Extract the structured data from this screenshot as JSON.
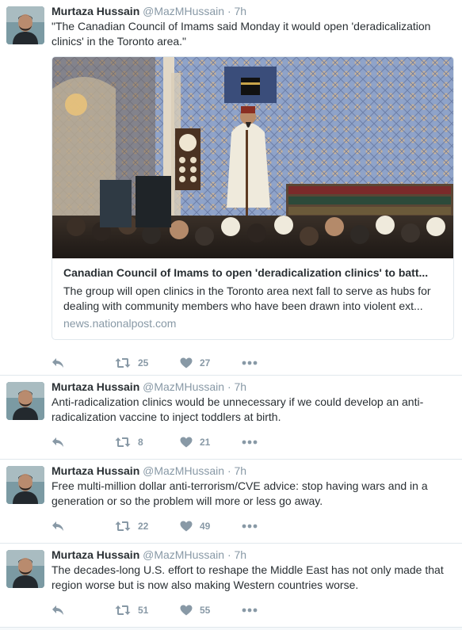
{
  "colors": {
    "text": "#292f33",
    "muted": "#8899a6",
    "border": "#e1e8ed",
    "background": "#f5f8fa"
  },
  "icons": {
    "reply": "reply-icon",
    "retweet": "retweet-icon",
    "like": "heart-icon",
    "more": "more-icon"
  },
  "tweets": [
    {
      "name": "Murtaza Hussain",
      "handle": "@MazMHussain",
      "time": "· 7h",
      "text": "\"The Canadian Council of Imams said Monday it would open 'deradicalization clinics' in the Toronto area.\"",
      "card": {
        "title": "Canadian Council of Imams to open 'deradicalization clinics' to batt...",
        "description": "The group will open clinics in the Toronto area next fall to serve as hubs for dealing with community members who have been drawn into violent ext...",
        "url": "news.nationalpost.com"
      },
      "retweets": "25",
      "likes": "27"
    },
    {
      "name": "Murtaza Hussain",
      "handle": "@MazMHussain",
      "time": "· 7h",
      "text": "Anti-radicalization clinics would be unnecessary if we could develop an anti-radicalization vaccine to inject toddlers at birth.",
      "retweets": "8",
      "likes": "21"
    },
    {
      "name": "Murtaza Hussain",
      "handle": "@MazMHussain",
      "time": "· 7h",
      "text": "Free multi-million dollar anti-terrorism/CVE advice: stop having wars and in a generation or so the problem will more or less go away.",
      "retweets": "22",
      "likes": "49"
    },
    {
      "name": "Murtaza Hussain",
      "handle": "@MazMHussain",
      "time": "· 7h",
      "text": "The decades-long U.S. effort to reshape the Middle East has not only made that region worse but is now also making Western countries worse.",
      "retweets": "51",
      "likes": "55"
    }
  ]
}
